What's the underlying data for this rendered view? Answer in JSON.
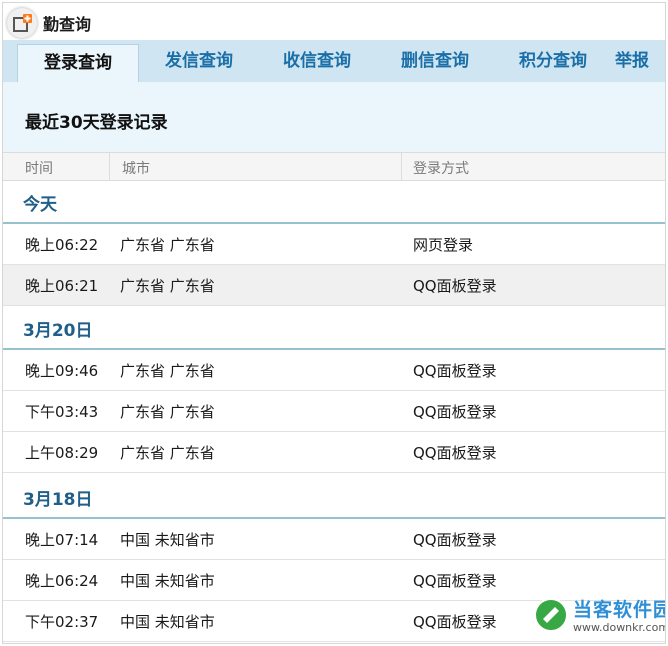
{
  "header": {
    "title": "勤查询"
  },
  "tabs": [
    {
      "label": "登录查询",
      "active": true
    },
    {
      "label": "发信查询",
      "active": false
    },
    {
      "label": "收信查询",
      "active": false
    },
    {
      "label": "删信查询",
      "active": false
    },
    {
      "label": "积分查询",
      "active": false
    },
    {
      "label": "举报",
      "active": false
    }
  ],
  "panel": {
    "title": "最近30天登录记录"
  },
  "columns": {
    "time": "时间",
    "city": "城市",
    "method": "登录方式"
  },
  "groups": [
    {
      "label": "今天",
      "rows": [
        {
          "time": "晚上06:22",
          "city": "广东省 广东省",
          "method": "网页登录"
        },
        {
          "time": "晚上06:21",
          "city": "广东省 广东省",
          "method": "QQ面板登录"
        }
      ]
    },
    {
      "label": "3月20日",
      "rows": [
        {
          "time": "晚上09:46",
          "city": "广东省 广东省",
          "method": "QQ面板登录"
        },
        {
          "time": "下午03:43",
          "city": "广东省 广东省",
          "method": "QQ面板登录"
        },
        {
          "time": "上午08:29",
          "city": "广东省 广东省",
          "method": "QQ面板登录"
        }
      ]
    },
    {
      "label": "3月18日",
      "rows": [
        {
          "time": "晚上07:14",
          "city": "中国 未知省市",
          "method": "QQ面板登录"
        },
        {
          "time": "晚上06:24",
          "city": "中国 未知省市",
          "method": "QQ面板登录"
        },
        {
          "time": "下午02:37",
          "city": "中国 未知省市",
          "method": "QQ面板登录"
        }
      ]
    }
  ],
  "watermark": {
    "name": "当客软件园",
    "url": "www.downkr.com"
  },
  "icons": {
    "corner": "add-window-icon",
    "watermark": "brand-logo-icon"
  },
  "colors": {
    "tab_bar": "#cfe6f2",
    "panel": "#eaf6fc",
    "group_label": "#1f5f8a",
    "tab_text": "#1b6fa8"
  }
}
